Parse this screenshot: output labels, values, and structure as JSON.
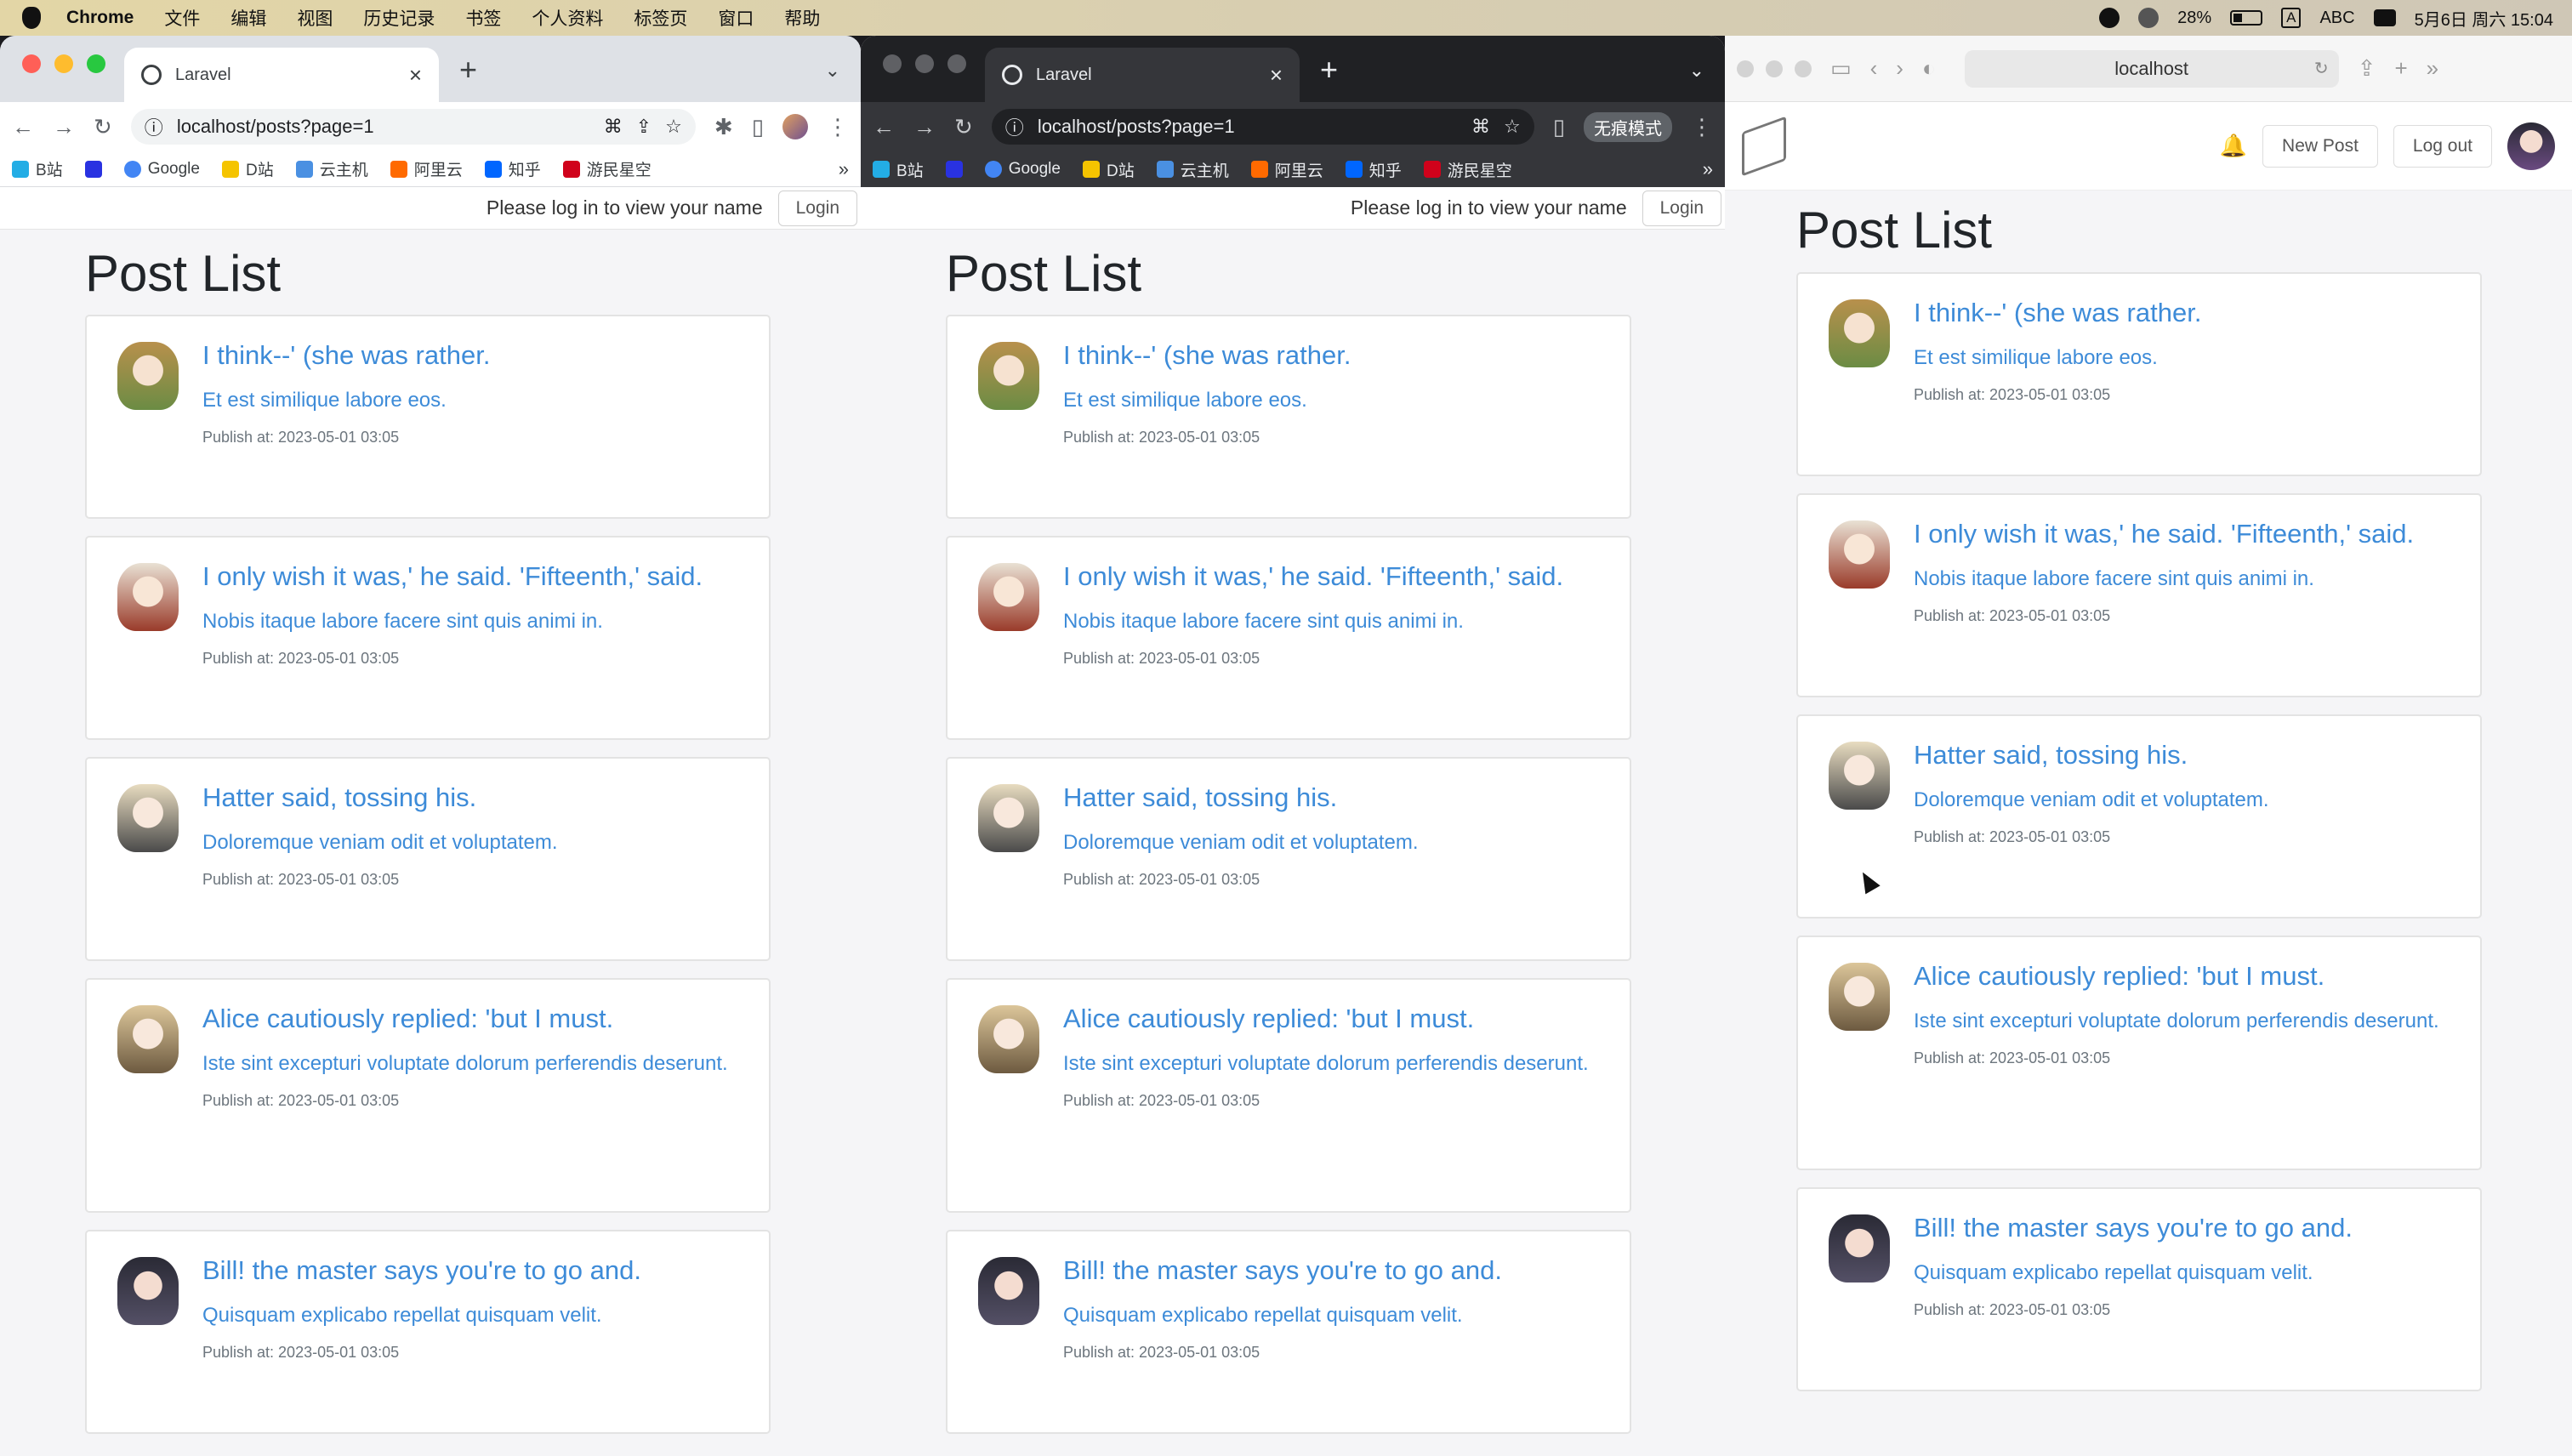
{
  "menubar": {
    "app": "Chrome",
    "items": [
      "文件",
      "编辑",
      "视图",
      "历史记录",
      "书签",
      "个人资料",
      "标签页",
      "窗口",
      "帮助"
    ],
    "battery": "28%",
    "input": "ABC",
    "input_badge": "A",
    "datetime": "5月6日 周六 15:04"
  },
  "chrome1": {
    "tab_title": "Laravel",
    "url": "localhost/posts?page=1",
    "bookmarks": [
      "B站",
      "",
      "Google",
      "D站",
      "云主机",
      "阿里云",
      "知乎",
      "游民星空"
    ]
  },
  "chrome2": {
    "tab_title": "Laravel",
    "url": "localhost/posts?page=1",
    "incognito_label": "无痕模式",
    "bookmarks": [
      "B站",
      "",
      "Google",
      "D站",
      "云主机",
      "阿里云",
      "知乎",
      "游民星空"
    ]
  },
  "guest_nav": {
    "message": "Please log in to view your name",
    "login_label": "Login"
  },
  "safari": {
    "address": "localhost",
    "new_post_label": "New Post",
    "logout_label": "Log out"
  },
  "page": {
    "title": "Post List",
    "posts": [
      {
        "title": "I think--' (she was rather.",
        "excerpt": "Et est similique labore eos.",
        "published": "Publish at: 2023-05-01 03:05"
      },
      {
        "title": "I only wish it was,' he said. 'Fifteenth,' said.",
        "excerpt": "Nobis itaque labore facere sint quis animi in.",
        "published": "Publish at: 2023-05-01 03:05"
      },
      {
        "title": "Hatter said, tossing his.",
        "excerpt": "Doloremque veniam odit et voluptatem.",
        "published": "Publish at: 2023-05-01 03:05"
      },
      {
        "title": "Alice cautiously replied: 'but I must.",
        "excerpt": "Iste sint excepturi voluptate dolorum perferendis deserunt.",
        "published": "Publish at: 2023-05-01 03:05"
      },
      {
        "title": "Bill! the master says you're to go and.",
        "excerpt": "Quisquam explicabo repellat quisquam velit.",
        "published": "Publish at: 2023-05-01 03:05"
      }
    ]
  },
  "colors": {
    "link": "#3d8bd8",
    "muted": "#6c757d",
    "page_bg": "#f5f5f7"
  }
}
